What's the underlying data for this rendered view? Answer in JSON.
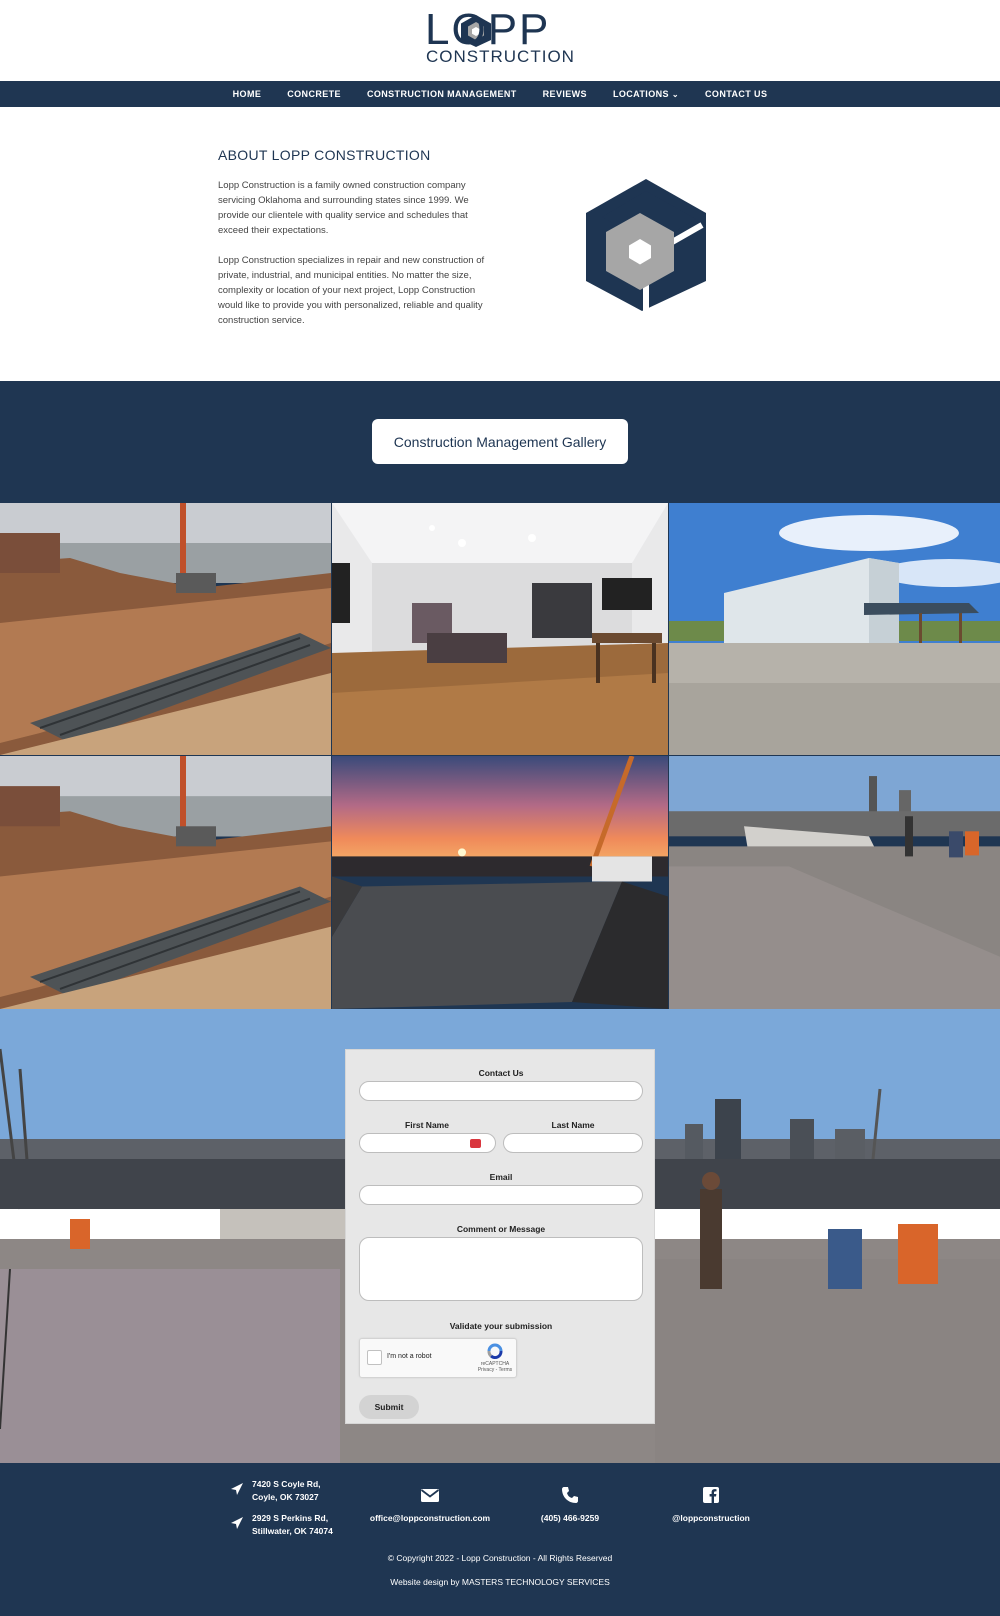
{
  "brand": {
    "logo_word": "LOPP",
    "logo_sub": "CONSTRUCTION",
    "color_primary": "#1f3652",
    "color_gray": "#a6a6a6"
  },
  "nav": {
    "items": [
      {
        "label": "HOME"
      },
      {
        "label": "CONCRETE"
      },
      {
        "label": "CONSTRUCTION MANAGEMENT"
      },
      {
        "label": "REVIEWS"
      },
      {
        "label": "LOCATIONS",
        "has_dropdown": true
      },
      {
        "label": "CONTACT US"
      }
    ]
  },
  "about": {
    "title": "ABOUT LOPP CONSTRUCTION",
    "p1": "Lopp Construction is a family owned construction company servicing Oklahoma and surrounding states since 1999. We provide our clientele with quality service and schedules that exceed their expectations.",
    "p2": "Lopp Construction specializes in repair and new construction of private, industrial, and municipal entities. No matter the size, complexity or location of your next project, Lopp Construction would like to provide you with personalized, reliable and quality construction service."
  },
  "gallery": {
    "button_label": "Construction Management Gallery",
    "photos": [
      {
        "icon": "rebar-trench-photo"
      },
      {
        "icon": "interior-kitchen-photo"
      },
      {
        "icon": "metal-building-photo"
      },
      {
        "icon": "rebar-trench-photo"
      },
      {
        "icon": "sunset-concrete-pour-photo"
      },
      {
        "icon": "concrete-slab-workers-photo"
      }
    ]
  },
  "contact_form": {
    "title": "Contact Us",
    "first_name_label": "First Name",
    "last_name_label": "Last Name",
    "email_label": "Email",
    "comment_label": "Comment or Message",
    "validate_label": "Validate your submission",
    "captcha_text": "I'm not a robot",
    "captcha_brand": "reCAPTCHA",
    "captcha_terms": "Privacy - Terms",
    "submit_label": "Submit"
  },
  "footer": {
    "address1_line1": "7420 S Coyle Rd,",
    "address1_line2": "Coyle, OK 73027",
    "address2_line1": "2929 S Perkins Rd,",
    "address2_line2": "Stillwater, OK 74074",
    "email": "office@loppconstruction.com",
    "phone": "(405) 466-9259",
    "facebook": "@loppconstruction",
    "copyright": "© Copyright 2022 - Lopp Construction - All Rights Reserved",
    "credit": "Website design by MASTERS TECHNOLOGY SERVICES"
  }
}
